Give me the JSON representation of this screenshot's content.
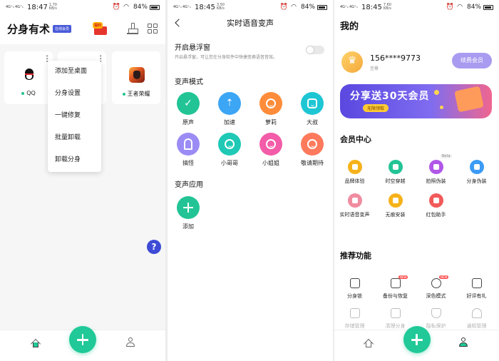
{
  "panel1": {
    "status": {
      "signal": "4G⁺ᵢₗ 4G⁺ᵢₗ",
      "time": "18:47",
      "speed": "1.70 KB/s",
      "battery": "84%"
    },
    "title": "分身有术",
    "vip_badge": "在线会员",
    "gift_tag": "福利",
    "apps": [
      {
        "label": "QQ"
      },
      {
        "label": "王者荣耀"
      }
    ],
    "menu": [
      "添加至桌面",
      "分身设置",
      "一键修复",
      "批量卸载",
      "卸载分身"
    ],
    "help": "?"
  },
  "panel2": {
    "status": {
      "signal": "4G⁺ᵢₗ 4G⁺ᵢₗ",
      "time": "18:45",
      "speed": "3.50 KB/s",
      "battery": "84%"
    },
    "title": "实时语音变声",
    "float_title": "开启悬浮窗",
    "float_desc": "开启悬浮窗，可让您在分身软件中快捷变换语音音效。",
    "mode_section": "变声模式",
    "modes": [
      "原声",
      "加速",
      "萝莉",
      "大叔",
      "搞怪",
      "小哥哥",
      "小姐姐",
      "敬请期待"
    ],
    "app_section": "变声应用",
    "add_label": "添加",
    "colors": {
      "green": "#22c495",
      "blue": "#3ca6f5",
      "orange": "#ff8c3a",
      "cyan": "#1ec6d4",
      "purple": "#9b8cf5",
      "teal": "#1fc9b6",
      "pink": "#f25ca8",
      "salmon": "#ff7a5c"
    }
  },
  "panel3": {
    "status": {
      "signal": "4G⁺ᵢₗ 4G⁺ᵢₗ",
      "time": "18:45",
      "speed": "7.60 KB/s",
      "battery": "84%"
    },
    "title": "我的",
    "phone": "156****9773",
    "level": "至尊",
    "renew": "续费会员",
    "banner_big": "分享送30天会员",
    "banner_small": "无限领取",
    "member_section": "会员中心",
    "member_items": [
      {
        "label": "品牌体验",
        "color": "#f6b21a"
      },
      {
        "label": "时空穿越",
        "color": "#22c495"
      },
      {
        "label": "拍照伪装",
        "color": "#b057e8",
        "beta": "Beta"
      },
      {
        "label": "分身伪装",
        "color": "#3b9bf6"
      },
      {
        "label": "实时语音变声",
        "color": "#f08ca0"
      },
      {
        "label": "无痕安装",
        "color": "#f6b21a"
      },
      {
        "label": "红包助手",
        "color": "#f25a5a"
      }
    ],
    "rec_section": "推荐功能",
    "rec_items": [
      {
        "label": "分身锁"
      },
      {
        "label": "备份与恢复",
        "tag": "NEW"
      },
      {
        "label": "深色模式",
        "tag": "NEW"
      },
      {
        "label": "好评有礼"
      },
      {
        "label": "存储管理"
      },
      {
        "label": "清理分身"
      },
      {
        "label": "隐私保护"
      },
      {
        "label": "通知管理"
      }
    ]
  }
}
